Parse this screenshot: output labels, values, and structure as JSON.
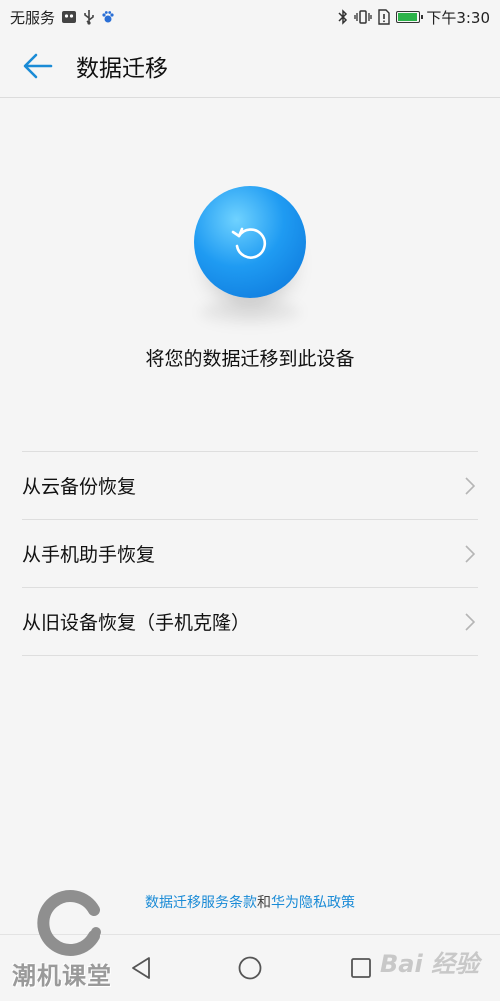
{
  "status_bar": {
    "carrier": "无服务",
    "time": "下午3:30",
    "battery_level": 0.95
  },
  "header": {
    "title": "数据迁移",
    "back_icon": "back-arrow-icon"
  },
  "hero": {
    "icon": "restore-refresh-icon",
    "text": "将您的数据迁移到此设备"
  },
  "options": [
    {
      "label": "从云备份恢复"
    },
    {
      "label": "从手机助手恢复"
    },
    {
      "label": "从旧设备恢复（手机克隆）"
    }
  ],
  "footer": {
    "link1": "数据迁移服务条款",
    "and": "和",
    "link2": "华为隐私政策"
  },
  "watermarks": {
    "left": "潮机课堂",
    "right": "Bai 经验"
  },
  "colors": {
    "accent": "#1a8bd6",
    "orb": "#1f9bf2"
  }
}
